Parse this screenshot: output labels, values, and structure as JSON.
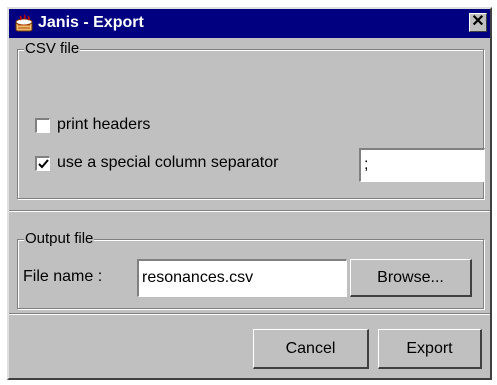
{
  "window": {
    "title": "Janis - Export",
    "app_icon": "janis-app-icon",
    "close_icon": "close-icon",
    "close_glyph": "✕"
  },
  "csv_section": {
    "legend": "CSV file",
    "print_headers": {
      "label": "print headers",
      "checked": false
    },
    "special_separator": {
      "label": "use a special column separator",
      "checked": true,
      "value": ";"
    }
  },
  "output_section": {
    "legend": "Output file",
    "file_name_label": "File name :",
    "file_name_value": "resonances.csv",
    "browse_label": "Browse..."
  },
  "actions": {
    "cancel_label": "Cancel",
    "export_label": "Export"
  },
  "colors": {
    "titlebar": "#000080",
    "face": "#c0c0c0"
  }
}
